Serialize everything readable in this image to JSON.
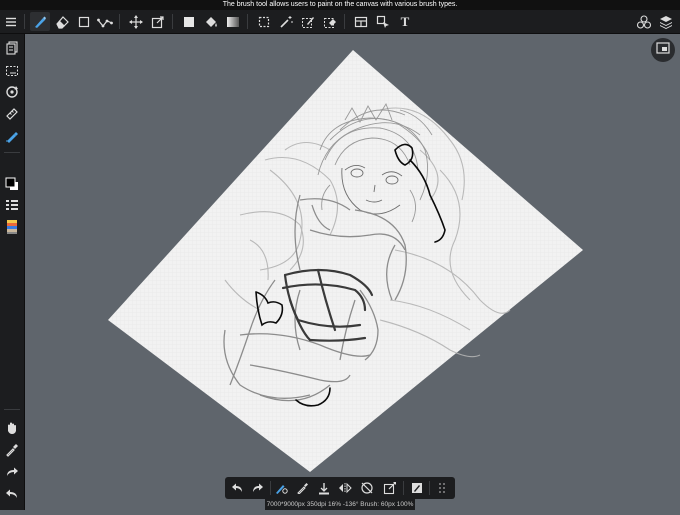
{
  "tooltip": {
    "text": "The brush tool allows users to paint on the canvas with various brush types."
  },
  "toolbar": {
    "text_tool_glyph": "T",
    "icons": [
      "menu-icon",
      "brush-icon",
      "eraser-icon",
      "rectangle-icon",
      "lasso-line-icon",
      "move-icon",
      "transform-icon",
      "fill-color-icon",
      "bucket-icon",
      "gradient-icon",
      "select-rect-icon",
      "magic-wand-icon",
      "select-pen-icon",
      "select-eraser-icon",
      "frame-icon",
      "auto-select-icon",
      "text-icon",
      "materials-icon",
      "layers-icon"
    ]
  },
  "sidebar": {
    "icons": [
      "layers-panel-icon",
      "select-all-icon",
      "rotate-icon",
      "ruler-icon",
      "snap-icon",
      "color-swatch-icon",
      "brush-list-icon",
      "color-palette-icon",
      "hand-icon",
      "eyedropper-icon",
      "redo-icon",
      "undo-icon"
    ]
  },
  "bottom_toolbar": {
    "icons": [
      "undo-icon",
      "redo-icon",
      "brush-settings-icon",
      "eyedropper-icon",
      "save-icon",
      "flip-icon",
      "rotate-reset-icon",
      "transform-icon",
      "shape-icon",
      "more-icon"
    ]
  },
  "status": {
    "text": "7000*9000px 350dpi 16% -136° Brush: 60px 100%"
  },
  "colors": {
    "accent": "#4aa3e8",
    "toolbar_bg": "#1c1d1f",
    "workspace_bg": "#5f656c"
  }
}
